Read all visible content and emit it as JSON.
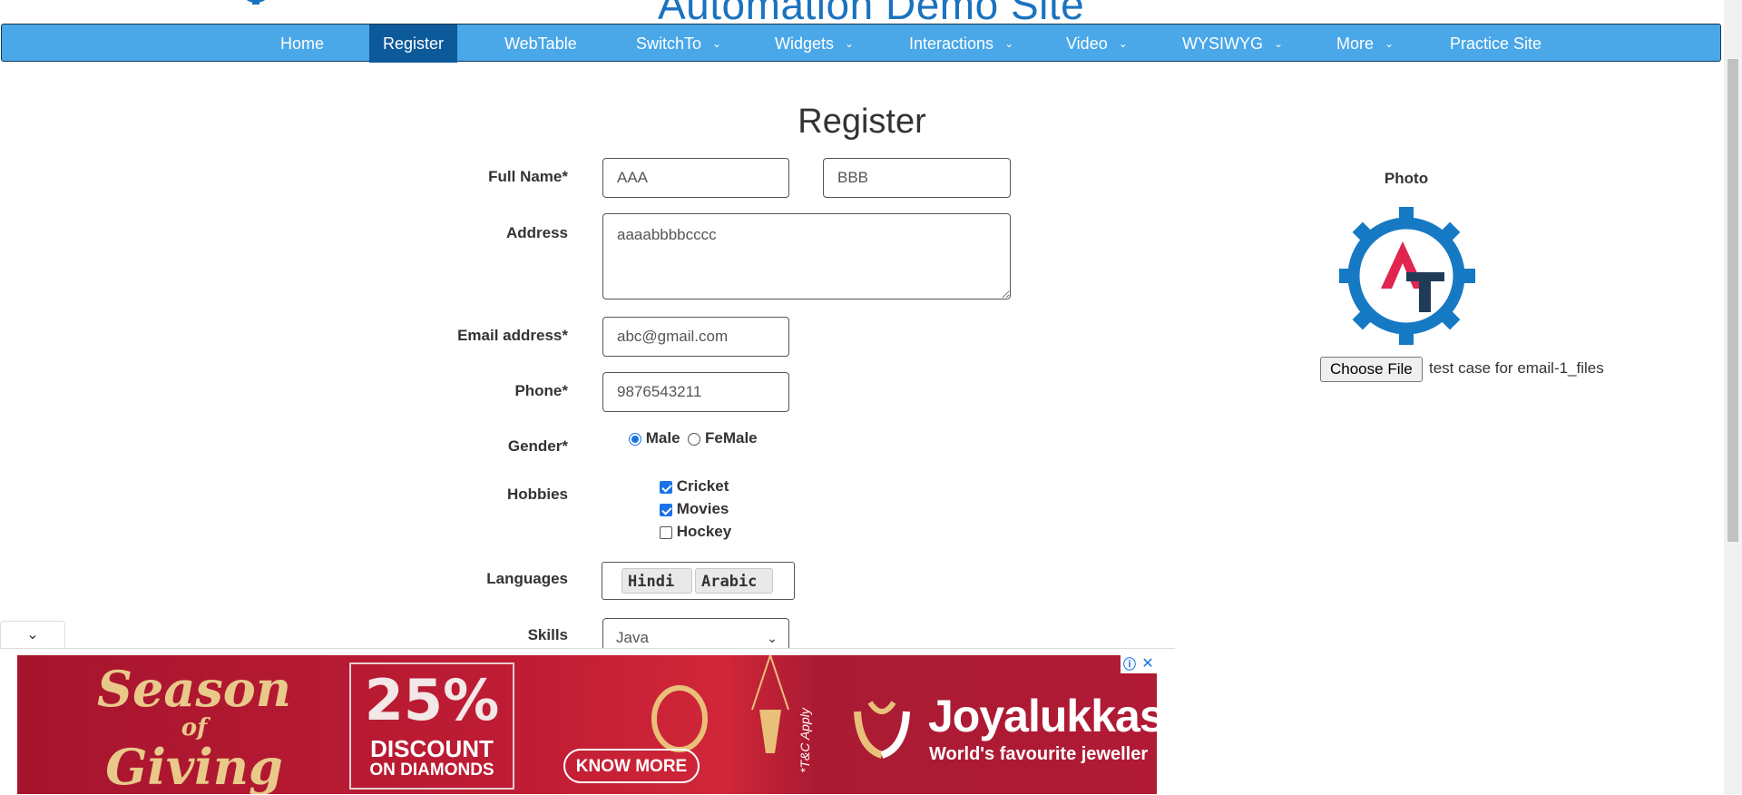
{
  "header": {
    "site_title": "Automation Demo Site"
  },
  "nav": {
    "items": [
      {
        "label": "Home",
        "dropdown": false,
        "active": false
      },
      {
        "label": "Register",
        "dropdown": false,
        "active": true
      },
      {
        "label": "WebTable",
        "dropdown": false,
        "active": false
      },
      {
        "label": "SwitchTo",
        "dropdown": true,
        "active": false
      },
      {
        "label": "Widgets",
        "dropdown": true,
        "active": false
      },
      {
        "label": "Interactions",
        "dropdown": true,
        "active": false
      },
      {
        "label": "Video",
        "dropdown": true,
        "active": false
      },
      {
        "label": "WYSIWYG",
        "dropdown": true,
        "active": false
      },
      {
        "label": "More",
        "dropdown": true,
        "active": false
      },
      {
        "label": "Practice Site",
        "dropdown": false,
        "active": false
      }
    ],
    "bg_color": "#4aa7e8",
    "active_color": "#0d5a9b"
  },
  "form": {
    "title": "Register",
    "full_name": {
      "label": "Full Name*",
      "first_value": "AAA",
      "last_value": "BBB"
    },
    "address": {
      "label": "Address",
      "value": "aaaabbbbcccc"
    },
    "email": {
      "label": "Email address*",
      "value": "abc@gmail.com"
    },
    "phone": {
      "label": "Phone*",
      "value": "9876543211"
    },
    "gender": {
      "label": "Gender*",
      "options": [
        "Male",
        "FeMale"
      ],
      "selected": "Male"
    },
    "hobbies": {
      "label": "Hobbies",
      "options": [
        {
          "label": "Cricket",
          "checked": true
        },
        {
          "label": "Movies",
          "checked": true
        },
        {
          "label": "Hockey",
          "checked": false
        }
      ]
    },
    "languages": {
      "label": "Languages",
      "selected": [
        "Hindi",
        "Arabic"
      ]
    },
    "skills": {
      "label": "Skills",
      "value": "Java"
    }
  },
  "photo": {
    "label": "Photo",
    "choose_file_label": "Choose File",
    "file_name": "test case for email-1_files"
  },
  "ad": {
    "season_line1": "Season",
    "season_line2": "of",
    "season_line3": "Giving",
    "discount_pct": "25%",
    "discount_line1": "DISCOUNT",
    "discount_line2": "ON DIAMONDS",
    "cta": "KNOW MORE",
    "tc": "*T&C Apply",
    "brand": "Joyalukkas",
    "tagline": "World's favourite jeweller",
    "info_icon": "ⓘ",
    "close_icon": "✕"
  }
}
